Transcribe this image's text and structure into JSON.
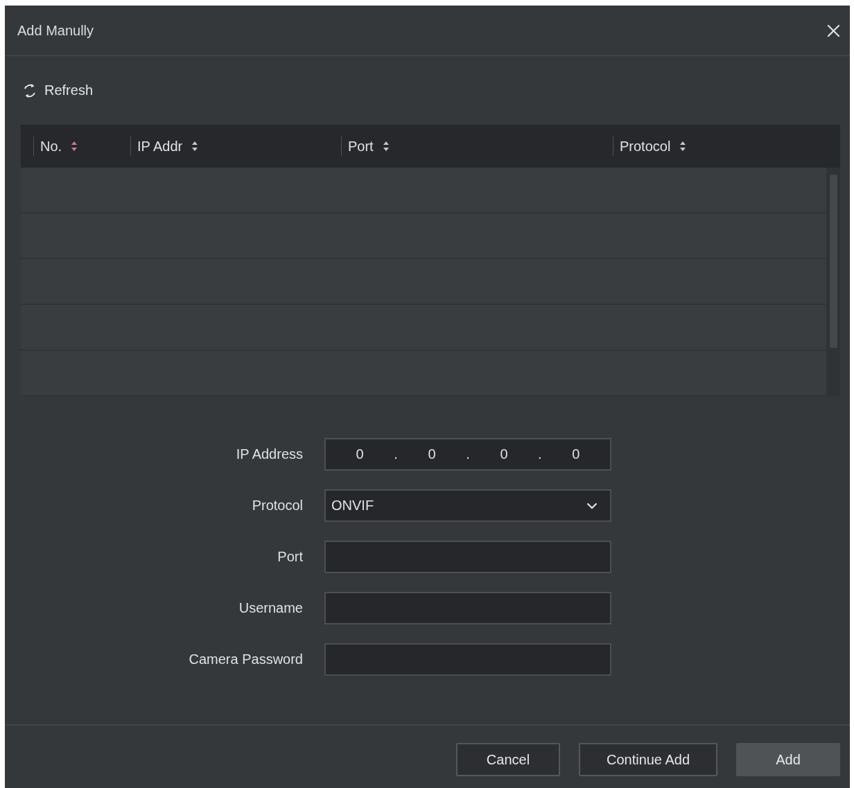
{
  "window": {
    "title": "Add Manully"
  },
  "toolbar": {
    "refresh": "Refresh"
  },
  "table": {
    "columns": [
      {
        "label": "No.",
        "sorted": true
      },
      {
        "label": "IP Addr",
        "sorted": false
      },
      {
        "label": "Port",
        "sorted": false
      },
      {
        "label": "Protocol",
        "sorted": false
      }
    ]
  },
  "form": {
    "fields": [
      {
        "kind": "ip",
        "label": "IP Address",
        "octets": [
          "0",
          "0",
          "0",
          "0"
        ],
        "separators": [
          ".",
          ".",
          "."
        ]
      },
      {
        "kind": "select",
        "label": "Protocol",
        "value": "ONVIF"
      },
      {
        "kind": "text",
        "label": "Port"
      },
      {
        "kind": "text",
        "label": "Username"
      },
      {
        "kind": "text",
        "label": "Camera Password"
      }
    ]
  },
  "buttons": [
    {
      "label": "Cancel",
      "kind": "outline"
    },
    {
      "label": "Continue Add",
      "kind": "outline"
    },
    {
      "label": "Add",
      "kind": "filled"
    }
  ]
}
